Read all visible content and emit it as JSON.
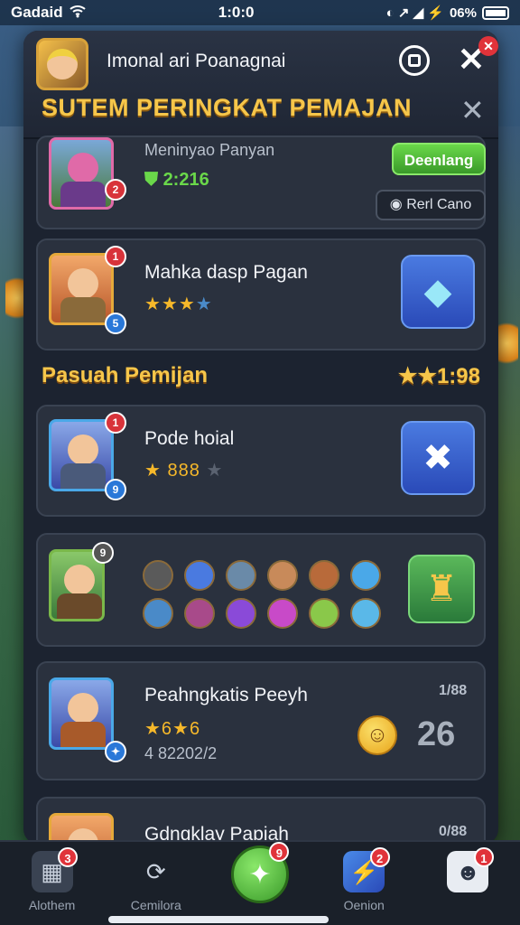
{
  "status_bar": {
    "carrier": "Gadaid",
    "time": "1:0:0",
    "battery_pct": "06%"
  },
  "header": {
    "subtitle": "Imonal ari Poanagnai",
    "title": "SUTEM PERINGKAT PEMAJAN"
  },
  "cards": [
    {
      "title": "Meninyao Panyan",
      "score": "2:216",
      "primary_btn": "Deenlang",
      "secondary_btn": "Rerl Cano",
      "badge": "2"
    },
    {
      "title": "Mahka dasp Pagan",
      "stars": "★★★",
      "empty_star": "★",
      "badge": "1",
      "badge2": "5"
    }
  ],
  "section": {
    "title": "Pasuah Pemijan",
    "score": "★★1:98"
  },
  "cards2": [
    {
      "title": "Pode hoial",
      "stars": "★",
      "stars_num": "888",
      "grey_star": "★",
      "badge": "1",
      "badge2": "9"
    },
    {
      "badge": "9"
    },
    {
      "title": "Peahngkatis Peeyh",
      "stars": "★6★6",
      "sub": "4 82202/2",
      "small_num": "1/88",
      "big_num": "26"
    },
    {
      "title": "Gdngklay Papiah",
      "small_num": "0/88"
    }
  ],
  "nav": [
    {
      "label": "Alothem",
      "badge": "3",
      "icon": "calendar-icon"
    },
    {
      "label": "Cemilora",
      "badge": "",
      "icon": "refresh-icon"
    },
    {
      "label": "",
      "badge": "9",
      "icon": "play-icon"
    },
    {
      "label": "Oenion",
      "badge": "2",
      "icon": "lightning-icon"
    },
    {
      "label": "",
      "badge": "1",
      "icon": "robot-icon"
    }
  ],
  "colors": {
    "accent_gold": "#f6c64a",
    "accent_green": "#6ad84a",
    "panel_bg": "#1c2330",
    "badge_red": "#e0333a"
  }
}
